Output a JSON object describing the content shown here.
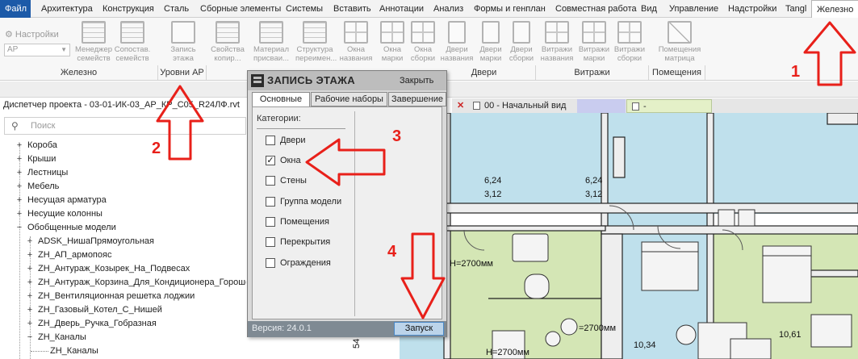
{
  "menubar": {
    "items": [
      "Файл",
      "Архитектура",
      "Конструкция",
      "Сталь",
      "Сборные элементы",
      "Системы",
      "Вставить",
      "Аннотации",
      "Анализ",
      "Формы и генплан",
      "Совместная работа",
      "Вид",
      "Управление",
      "Надстройки",
      "Tangl",
      "Железно"
    ],
    "active": "Железно"
  },
  "ribbon": {
    "settings_label": "Настройки",
    "filter_value": "АР",
    "buttons": [
      {
        "label": "Менеджер семейств"
      },
      {
        "label": "Сопостав. семейств"
      },
      {
        "label": "Запись этажа"
      },
      {
        "label": "Свойства копир..."
      },
      {
        "label": "Материал присваи..."
      },
      {
        "label": "Структура переимен..."
      },
      {
        "label": "Окна названия"
      },
      {
        "label": "Окна марки"
      },
      {
        "label": "Окна сборки"
      },
      {
        "label": "Двери названия"
      },
      {
        "label": "Двери марки"
      },
      {
        "label": "Двери сборки"
      },
      {
        "label": "Витражи названия"
      },
      {
        "label": "Витражи марки"
      },
      {
        "label": "Витражи сборки"
      },
      {
        "label": "Помещения матрица"
      }
    ],
    "groups": [
      "Железно",
      "Уровни АР",
      "Двери",
      "Витражи",
      "Помещения"
    ]
  },
  "project_browser": {
    "title": "Диспетчер проекта - 03-01-ИК-03_АР_КР_С05_R24ЛФ.rvt",
    "search_placeholder": "Поиск",
    "items": [
      {
        "label": "Короба",
        "expander": "+",
        "level": 0
      },
      {
        "label": "Крыши",
        "expander": "+",
        "level": 0
      },
      {
        "label": "Лестницы",
        "expander": "+",
        "level": 0
      },
      {
        "label": "Мебель",
        "expander": "+",
        "level": 0
      },
      {
        "label": "Несущая арматура",
        "expander": "+",
        "level": 0
      },
      {
        "label": "Несущие колонны",
        "expander": "+",
        "level": 0
      },
      {
        "label": "Обобщенные модели",
        "expander": "−",
        "level": 0
      },
      {
        "label": "ADSK_НишаПрямоугольная",
        "expander": "+",
        "level": 1
      },
      {
        "label": "ZH_АП_армопояс",
        "expander": "+",
        "level": 1
      },
      {
        "label": "ZH_Антураж_Козырек_На_Подвесах",
        "expander": "+",
        "level": 1
      },
      {
        "label": "ZH_Антураж_Корзина_Для_Кондиционера_Горошек",
        "expander": "+",
        "level": 1
      },
      {
        "label": "ZH_Вентиляционная решетка лоджии",
        "expander": "+",
        "level": 1
      },
      {
        "label": "ZH_Газовый_Котел_С_Нишей",
        "expander": "+",
        "level": 1
      },
      {
        "label": "ZH_Дверь_Ручка_Гобразная",
        "expander": "+",
        "level": 1
      },
      {
        "label": "ZH_Каналы",
        "expander": "−",
        "level": 1
      },
      {
        "label": "ZH_Каналы",
        "expander": "",
        "level": 2
      }
    ]
  },
  "view_tabs": [
    {
      "label": "00 - Начальный вид"
    },
    {
      "label": "-"
    }
  ],
  "dialog": {
    "title": "ЗАПИСЬ ЭТАЖА",
    "close_label": "Закрыть",
    "tabs": [
      "Основные",
      "Рабочие наборы",
      "Завершение"
    ],
    "active_tab": "Основные",
    "categories_title": "Категории:",
    "categories": [
      {
        "label": "Двери",
        "checked": false
      },
      {
        "label": "Окна",
        "checked": true
      },
      {
        "label": "Стены",
        "checked": false
      },
      {
        "label": "Группа модели",
        "checked": false
      },
      {
        "label": "Помещения",
        "checked": false
      },
      {
        "label": "Перекрытия",
        "checked": false
      },
      {
        "label": "Ограждения",
        "checked": false
      }
    ],
    "version": "Версия: 24.0.1",
    "run_label": "Запуск"
  },
  "drawing": {
    "labels": [
      "6,24",
      "3,12",
      "6,24",
      "3,12",
      "H=2700мм",
      "=2700мм",
      "10,34",
      "10,61",
      "H=2700мм",
      "54"
    ]
  },
  "annotations": [
    "1",
    "2",
    "3",
    "4"
  ],
  "colors": {
    "accent": "#1c5aa8",
    "annotation": "#e8201a",
    "room_green": "#d4e6b5",
    "room_blue": "#bfe0ec"
  }
}
